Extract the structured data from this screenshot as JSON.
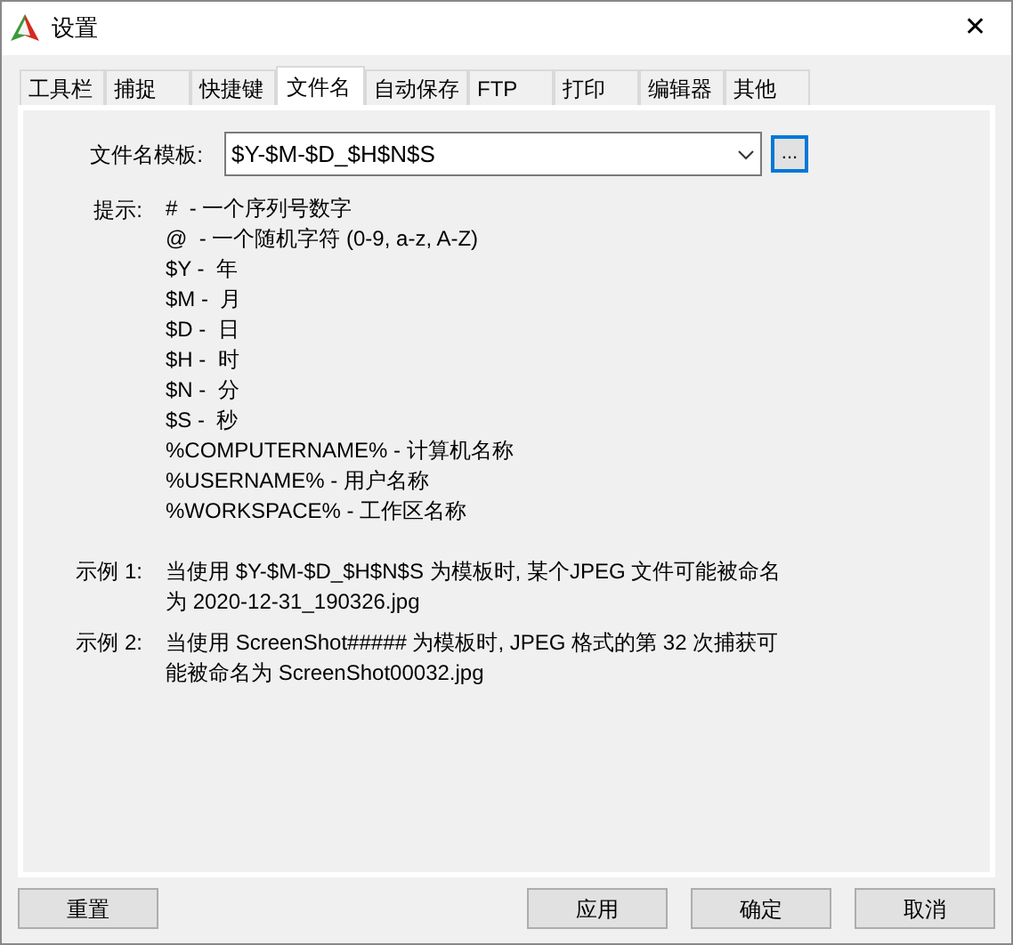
{
  "window": {
    "title": "设置",
    "close": "✕"
  },
  "tabs": [
    {
      "label": "工具栏",
      "selected": false
    },
    {
      "label": "捕捉",
      "selected": false
    },
    {
      "label": "快捷键",
      "selected": false
    },
    {
      "label": "文件名",
      "selected": true
    },
    {
      "label": "自动保存",
      "selected": false
    },
    {
      "label": "FTP",
      "selected": false
    },
    {
      "label": "打印",
      "selected": false
    },
    {
      "label": "编辑器",
      "selected": false
    },
    {
      "label": "其他",
      "selected": false
    }
  ],
  "template": {
    "label": "文件名模板:",
    "value": "$Y-$M-$D_$H$N$S",
    "browse": "..."
  },
  "hints": {
    "label": "提示:",
    "lines": [
      "#  - 一个序列号数字",
      "@  - 一个随机字符 (0-9, a-z, A-Z)",
      "$Y -  年",
      "$M -  月",
      "$D -  日",
      "$H -  时",
      "$N -  分",
      "$S -  秒",
      "%COMPUTERNAME% - 计算机名称",
      "%USERNAME% - 用户名称",
      "%WORKSPACE% - 工作区名称"
    ]
  },
  "examples": [
    {
      "label": "示例 1:",
      "text": "当使用 $Y-$M-$D_$H$N$S 为模板时, 某个JPEG 文件可能被命名为 2020-12-31_190326.jpg"
    },
    {
      "label": "示例 2:",
      "text": "当使用 ScreenShot##### 为模板时, JPEG 格式的第 32 次捕获可能被命名为 ScreenShot00032.jpg"
    }
  ],
  "buttons": {
    "left": [
      "重置"
    ],
    "right": [
      "应用",
      "确定",
      "取消"
    ]
  }
}
